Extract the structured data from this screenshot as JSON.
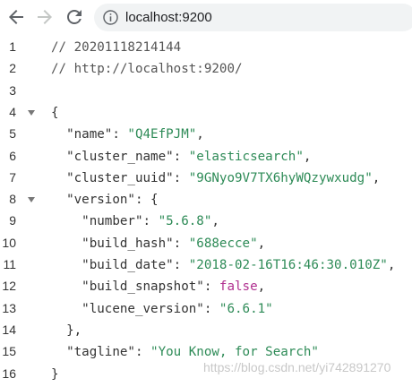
{
  "browser": {
    "url": "localhost:9200",
    "icons": [
      "back-icon",
      "forward-icon",
      "reload-icon",
      "info-icon"
    ]
  },
  "lines": [
    {
      "n": "1",
      "tokens": [
        {
          "t": "comment",
          "v": "// 20201118214144"
        }
      ]
    },
    {
      "n": "2",
      "tokens": [
        {
          "t": "comment",
          "v": "// http://localhost:9200/"
        }
      ]
    },
    {
      "n": "3",
      "tokens": []
    },
    {
      "n": "4",
      "fold": true,
      "tokens": [
        {
          "t": "p",
          "v": "{"
        }
      ]
    },
    {
      "n": "5",
      "tokens": [
        {
          "t": "p",
          "v": "  \"name\": "
        },
        {
          "t": "str",
          "v": "\"Q4EfPJM\""
        },
        {
          "t": "p",
          "v": ","
        }
      ]
    },
    {
      "n": "6",
      "tokens": [
        {
          "t": "p",
          "v": "  \"cluster_name\": "
        },
        {
          "t": "str",
          "v": "\"elasticsearch\""
        },
        {
          "t": "p",
          "v": ","
        }
      ]
    },
    {
      "n": "7",
      "tokens": [
        {
          "t": "p",
          "v": "  \"cluster_uuid\": "
        },
        {
          "t": "str",
          "v": "\"9GNyo9V7TX6hyWQzywxudg\""
        },
        {
          "t": "p",
          "v": ","
        }
      ]
    },
    {
      "n": "8",
      "fold": true,
      "tokens": [
        {
          "t": "p",
          "v": "  \"version\": {"
        }
      ]
    },
    {
      "n": "9",
      "tokens": [
        {
          "t": "p",
          "v": "    \"number\": "
        },
        {
          "t": "str",
          "v": "\"5.6.8\""
        },
        {
          "t": "p",
          "v": ","
        }
      ]
    },
    {
      "n": "10",
      "tokens": [
        {
          "t": "p",
          "v": "    \"build_hash\": "
        },
        {
          "t": "str",
          "v": "\"688ecce\""
        },
        {
          "t": "p",
          "v": ","
        }
      ]
    },
    {
      "n": "11",
      "tokens": [
        {
          "t": "p",
          "v": "    \"build_date\": "
        },
        {
          "t": "str",
          "v": "\"2018-02-16T16:46:30.010Z\""
        },
        {
          "t": "p",
          "v": ","
        }
      ]
    },
    {
      "n": "12",
      "tokens": [
        {
          "t": "p",
          "v": "    \"build_snapshot\": "
        },
        {
          "t": "kw",
          "v": "false"
        },
        {
          "t": "p",
          "v": ","
        }
      ]
    },
    {
      "n": "13",
      "tokens": [
        {
          "t": "p",
          "v": "    \"lucene_version\": "
        },
        {
          "t": "str",
          "v": "\"6.6.1\""
        }
      ]
    },
    {
      "n": "14",
      "tokens": [
        {
          "t": "p",
          "v": "  },"
        }
      ]
    },
    {
      "n": "15",
      "tokens": [
        {
          "t": "p",
          "v": "  \"tagline\": "
        },
        {
          "t": "str",
          "v": "\"You Know, for Search\""
        }
      ]
    },
    {
      "n": "16",
      "tokens": [
        {
          "t": "p",
          "v": "}"
        }
      ]
    }
  ],
  "watermark": "https://blog.csdn.net/yi742891270",
  "colors": {
    "string": "#2e8b57",
    "keyword": "#b03090",
    "comment": "#555555",
    "text": "#333333"
  }
}
